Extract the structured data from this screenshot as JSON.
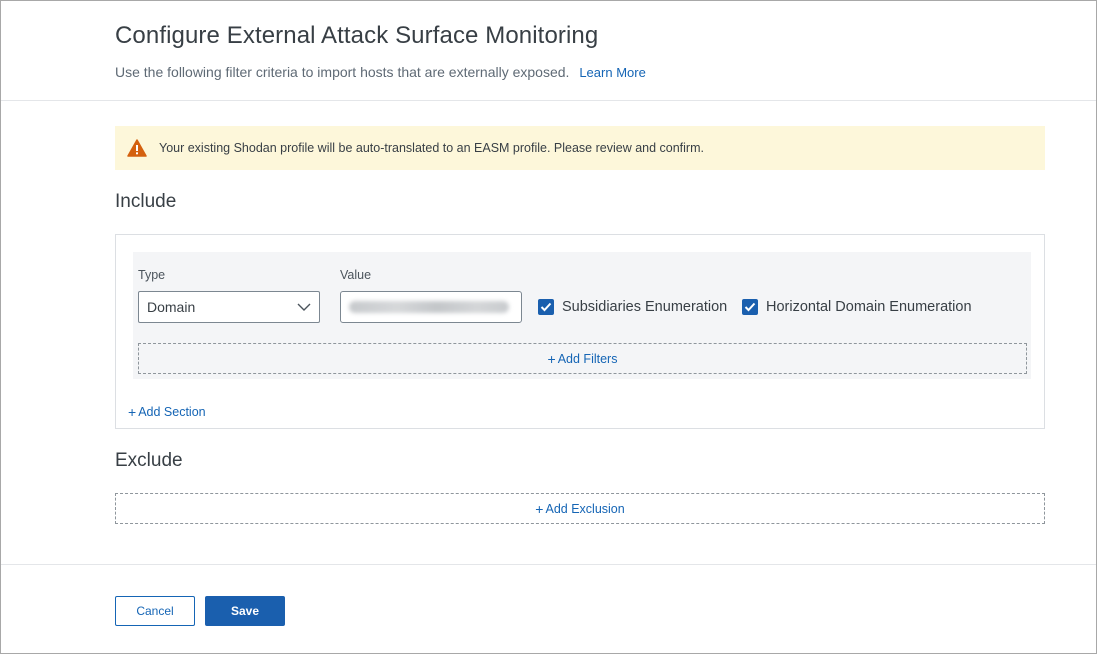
{
  "dialog": {
    "title": "Configure External Attack Surface Monitoring",
    "subtitle": "Use the following filter criteria to import hosts that are externally exposed.",
    "learn_more": "Learn More"
  },
  "warning": {
    "text": "Your existing Shodan profile will be auto-translated to an EASM profile. Please review and confirm.",
    "icon": "warning-triangle-icon",
    "color": "#d4610f"
  },
  "include": {
    "heading": "Include",
    "type_label": "Type",
    "value_label": "Value",
    "type_selected": "Domain",
    "value": "",
    "subsidiaries_label": "Subsidiaries Enumeration",
    "subsidiaries_checked": true,
    "horizontal_label": "Horizontal Domain Enumeration",
    "horizontal_checked": true,
    "add_filters": "Add Filters",
    "add_section": "Add Section"
  },
  "exclude": {
    "heading": "Exclude",
    "add_exclusion": "Add Exclusion"
  },
  "footer": {
    "cancel": "Cancel",
    "save": "Save"
  },
  "colors": {
    "accent": "#1565b5",
    "primary_button": "#1a5fae",
    "warning_bg": "#fdf7da"
  }
}
